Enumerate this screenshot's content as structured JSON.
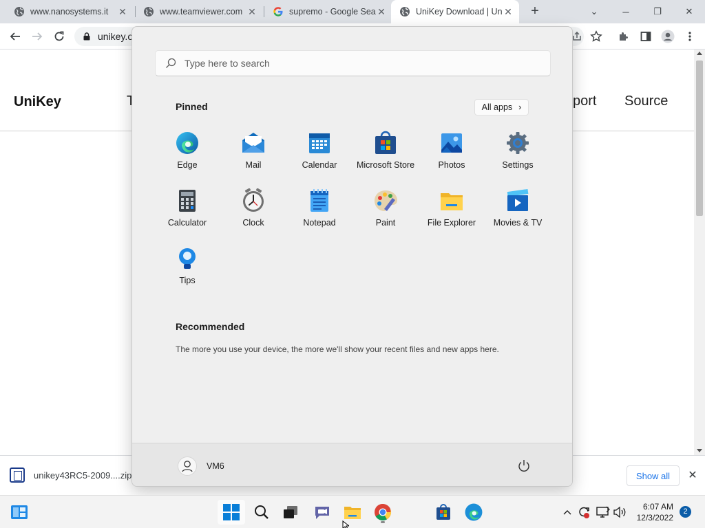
{
  "browser": {
    "tabs": [
      {
        "title": "www.nanosystems.it",
        "favicon": "globe-icon",
        "active": false
      },
      {
        "title": "www.teamviewer.com",
        "favicon": "globe-icon",
        "active": false
      },
      {
        "title": "supremo - Google Sea",
        "favicon": "google-icon",
        "active": false
      },
      {
        "title": "UniKey Download | Un",
        "favicon": "globe-icon",
        "active": true
      }
    ],
    "new_tab": "+",
    "window_controls": {
      "minimize": "─",
      "restore": "❐",
      "close": "✕",
      "tab_search": "⌄"
    },
    "address": "unikey.o"
  },
  "site": {
    "brand": "UniKey",
    "nav_partial": "T",
    "nav_support_partial": "port",
    "nav_source": "Source"
  },
  "downloads": {
    "file": "unikey43RC5-2009....zip",
    "show_all": "Show all",
    "close": "✕"
  },
  "start_menu": {
    "search_placeholder": "Type here to search",
    "pinned_title": "Pinned",
    "all_apps": "All apps",
    "all_apps_chevron": "›",
    "pinned": [
      {
        "label": "Edge",
        "icon": "edge-icon"
      },
      {
        "label": "Mail",
        "icon": "mail-icon"
      },
      {
        "label": "Calendar",
        "icon": "calendar-icon"
      },
      {
        "label": "Microsoft Store",
        "icon": "store-icon"
      },
      {
        "label": "Photos",
        "icon": "photos-icon"
      },
      {
        "label": "Settings",
        "icon": "settings-icon"
      },
      {
        "label": "Calculator",
        "icon": "calculator-icon"
      },
      {
        "label": "Clock",
        "icon": "clock-icon"
      },
      {
        "label": "Notepad",
        "icon": "notepad-icon"
      },
      {
        "label": "Paint",
        "icon": "paint-icon"
      },
      {
        "label": "File Explorer",
        "icon": "file-explorer-icon"
      },
      {
        "label": "Movies & TV",
        "icon": "movies-tv-icon"
      },
      {
        "label": "Tips",
        "icon": "tips-icon"
      }
    ],
    "recommended_title": "Recommended",
    "recommended_text": "The more you use your device, the more we'll show your recent files and new apps here.",
    "user": "VM6"
  },
  "taskbar": {
    "time": "6:07 AM",
    "date": "12/3/2022",
    "notifications": "2"
  },
  "colors": {
    "accent": "#0078d4",
    "link": "#1a73e8",
    "tabstrip": "#dee1e6",
    "start_bg": "#efefef"
  }
}
